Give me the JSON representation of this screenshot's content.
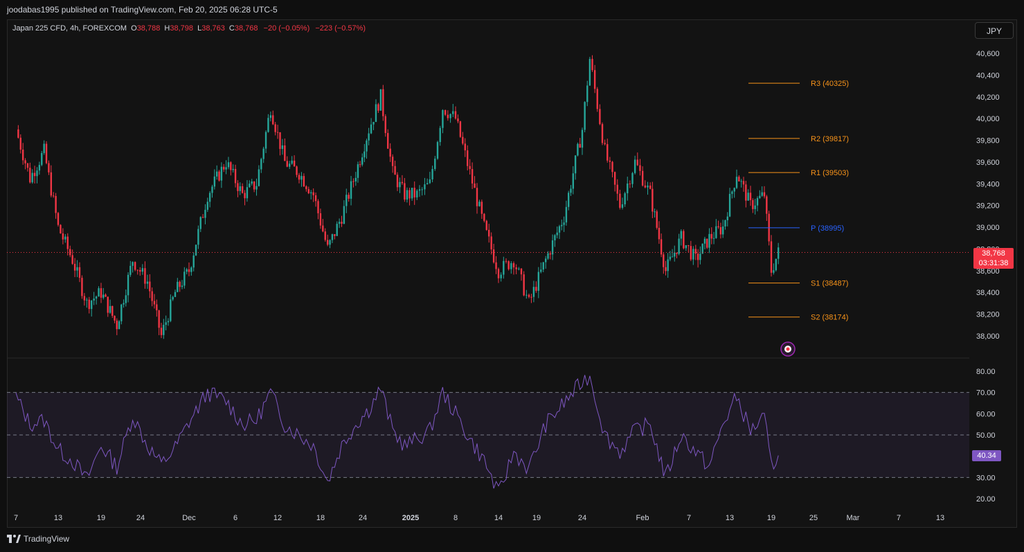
{
  "header": {
    "publisher": "joodabas1995 published on TradingView.com, Feb 20, 2025 06:28 UTC-5"
  },
  "legend": {
    "symbol": "Japan 225 CFD, 4h, FOREXCOM",
    "o_label": "O",
    "o_value": "38,788",
    "h_label": "H",
    "h_value": "38,798",
    "l_label": "L",
    "l_value": "38,763",
    "c_label": "C",
    "c_value": "38,768",
    "change": "−20 (−0.05%)",
    "change_total": "−223 (−0.57%)"
  },
  "currency_button": "JPY",
  "last_price_tag": {
    "price": "38,768",
    "countdown": "03:31:38"
  },
  "rsi_tag": "40.34",
  "footer": {
    "brand": "TradingView"
  },
  "colors": {
    "up": "#26a69a",
    "down": "#f23645",
    "pivot_orange": "#f7931a",
    "pivot_blue": "#2962ff",
    "rsi_line": "#7e57c2",
    "background": "#131313"
  },
  "chart_data": [
    {
      "type": "candlestick",
      "symbol": "Japan 225 CFD",
      "timeframe": "4h",
      "y_ticks": [
        "38,000",
        "38,200",
        "38,400",
        "38,600",
        "38,800",
        "39,000",
        "39,200",
        "39,400",
        "39,600",
        "39,800",
        "40,000",
        "40,200",
        "40,400",
        "40,600"
      ],
      "y_tick_values": [
        38000,
        38200,
        38400,
        38600,
        38800,
        39000,
        39200,
        39400,
        39600,
        39800,
        40000,
        40200,
        40400,
        40600
      ],
      "ylim": [
        37800,
        40750
      ],
      "x_ticks": [
        "7",
        "13",
        "19",
        "24",
        "Dec",
        "6",
        "12",
        "18",
        "24",
        "2025",
        "8",
        "14",
        "19",
        "24",
        "Feb",
        "7",
        "13",
        "19",
        "25",
        "Mar",
        "7",
        "13"
      ],
      "approx_path": [
        {
          "x": "Nov 7",
          "y": 39900
        },
        {
          "x": "Nov 9",
          "y": 39450
        },
        {
          "x": "Nov 11",
          "y": 39700
        },
        {
          "x": "Nov 13",
          "y": 39000
        },
        {
          "x": "Nov 15",
          "y": 38700
        },
        {
          "x": "Nov 17",
          "y": 38300
        },
        {
          "x": "Nov 19",
          "y": 38400
        },
        {
          "x": "Nov 21",
          "y": 38100
        },
        {
          "x": "Nov 23",
          "y": 38700
        },
        {
          "x": "Nov 25",
          "y": 38500
        },
        {
          "x": "Nov 27",
          "y": 38000
        },
        {
          "x": "Nov 29",
          "y": 38400
        },
        {
          "x": "Dec 1",
          "y": 38600
        },
        {
          "x": "Dec 3",
          "y": 39300
        },
        {
          "x": "Dec 5",
          "y": 39600
        },
        {
          "x": "Dec 7",
          "y": 39300
        },
        {
          "x": "Dec 9",
          "y": 39400
        },
        {
          "x": "Dec 11",
          "y": 40100
        },
        {
          "x": "Dec 13",
          "y": 39600
        },
        {
          "x": "Dec 15",
          "y": 39500
        },
        {
          "x": "Dec 17",
          "y": 39300
        },
        {
          "x": "Dec 19",
          "y": 38800
        },
        {
          "x": "Dec 21",
          "y": 39100
        },
        {
          "x": "Dec 23",
          "y": 39500
        },
        {
          "x": "Dec 25",
          "y": 39900
        },
        {
          "x": "Dec 27",
          "y": 40200
        },
        {
          "x": "Dec 29",
          "y": 39500
        },
        {
          "x": "Dec 31",
          "y": 39300
        },
        {
          "x": "Jan 2",
          "y": 39300
        },
        {
          "x": "Jan 4",
          "y": 39400
        },
        {
          "x": "Jan 6",
          "y": 40100
        },
        {
          "x": "Jan 8",
          "y": 40000
        },
        {
          "x": "Jan 10",
          "y": 39500
        },
        {
          "x": "Jan 12",
          "y": 39000
        },
        {
          "x": "Jan 14",
          "y": 38600
        },
        {
          "x": "Jan 16",
          "y": 38700
        },
        {
          "x": "Jan 18",
          "y": 38300
        },
        {
          "x": "Jan 20",
          "y": 38700
        },
        {
          "x": "Jan 22",
          "y": 39100
        },
        {
          "x": "Jan 24",
          "y": 39900
        },
        {
          "x": "Jan 25",
          "y": 40550
        },
        {
          "x": "Jan 27",
          "y": 39700
        },
        {
          "x": "Jan 29",
          "y": 39200
        },
        {
          "x": "Jan 31",
          "y": 39600
        },
        {
          "x": "Feb 2",
          "y": 39300
        },
        {
          "x": "Feb 4",
          "y": 38600
        },
        {
          "x": "Feb 6",
          "y": 38900
        },
        {
          "x": "Feb 8",
          "y": 38700
        },
        {
          "x": "Feb 10",
          "y": 38900
        },
        {
          "x": "Feb 12",
          "y": 39000
        },
        {
          "x": "Feb 14",
          "y": 39500
        },
        {
          "x": "Feb 16",
          "y": 39200
        },
        {
          "x": "Feb 18",
          "y": 39300
        },
        {
          "x": "Feb 19",
          "y": 38600
        },
        {
          "x": "Feb 20",
          "y": 38768
        }
      ],
      "pivots": [
        {
          "label": "R3 (40325)",
          "value": 40325,
          "color": "#f7931a"
        },
        {
          "label": "R2 (39817)",
          "value": 39817,
          "color": "#f7931a"
        },
        {
          "label": "R1 (39503)",
          "value": 39503,
          "color": "#f7931a"
        },
        {
          "label": "P (38995)",
          "value": 38995,
          "color": "#2962ff"
        },
        {
          "label": "S1 (38487)",
          "value": 38487,
          "color": "#f7931a"
        },
        {
          "label": "S2 (38174)",
          "value": 38174,
          "color": "#f7931a"
        }
      ],
      "last_price": 38768
    },
    {
      "type": "line",
      "y_ticks": [
        "20.00",
        "30.00",
        "40.00",
        "50.00",
        "60.00",
        "70.00",
        "80.00"
      ],
      "y_tick_values": [
        20,
        30,
        40,
        50,
        60,
        70,
        80
      ],
      "ylim": [
        17,
        82
      ],
      "bands": [
        70,
        50,
        30
      ],
      "approx_path": [
        {
          "x": "Nov 7",
          "y": 68
        },
        {
          "x": "Nov 9",
          "y": 55
        },
        {
          "x": "Nov 11",
          "y": 57
        },
        {
          "x": "Nov 13",
          "y": 43
        },
        {
          "x": "Nov 15",
          "y": 38
        },
        {
          "x": "Nov 17",
          "y": 29
        },
        {
          "x": "Nov 19",
          "y": 45
        },
        {
          "x": "Nov 21",
          "y": 35
        },
        {
          "x": "Nov 23",
          "y": 59
        },
        {
          "x": "Nov 25",
          "y": 45
        },
        {
          "x": "Nov 27",
          "y": 36
        },
        {
          "x": "Nov 29",
          "y": 44
        },
        {
          "x": "Dec 1",
          "y": 56
        },
        {
          "x": "Dec 3",
          "y": 70
        },
        {
          "x": "Dec 5",
          "y": 66
        },
        {
          "x": "Dec 7",
          "y": 55
        },
        {
          "x": "Dec 9",
          "y": 57
        },
        {
          "x": "Dec 11",
          "y": 70
        },
        {
          "x": "Dec 13",
          "y": 55
        },
        {
          "x": "Dec 15",
          "y": 50
        },
        {
          "x": "Dec 17",
          "y": 45
        },
        {
          "x": "Dec 19",
          "y": 28
        },
        {
          "x": "Dec 21",
          "y": 45
        },
        {
          "x": "Dec 23",
          "y": 55
        },
        {
          "x": "Dec 25",
          "y": 62
        },
        {
          "x": "Dec 27",
          "y": 72
        },
        {
          "x": "Dec 29",
          "y": 52
        },
        {
          "x": "Dec 31",
          "y": 45
        },
        {
          "x": "Jan 2",
          "y": 48
        },
        {
          "x": "Jan 4",
          "y": 52
        },
        {
          "x": "Jan 6",
          "y": 70
        },
        {
          "x": "Jan 8",
          "y": 60
        },
        {
          "x": "Jan 10",
          "y": 48
        },
        {
          "x": "Jan 12",
          "y": 38
        },
        {
          "x": "Jan 14",
          "y": 22
        },
        {
          "x": "Jan 16",
          "y": 42
        },
        {
          "x": "Jan 18",
          "y": 34
        },
        {
          "x": "Jan 20",
          "y": 55
        },
        {
          "x": "Jan 22",
          "y": 65
        },
        {
          "x": "Jan 24",
          "y": 75
        },
        {
          "x": "Jan 25",
          "y": 78
        },
        {
          "x": "Jan 27",
          "y": 50
        },
        {
          "x": "Jan 29",
          "y": 42
        },
        {
          "x": "Jan 31",
          "y": 52
        },
        {
          "x": "Feb 2",
          "y": 55
        },
        {
          "x": "Feb 4",
          "y": 30
        },
        {
          "x": "Feb 6",
          "y": 50
        },
        {
          "x": "Feb 8",
          "y": 42
        },
        {
          "x": "Feb 10",
          "y": 35
        },
        {
          "x": "Feb 12",
          "y": 55
        },
        {
          "x": "Feb 14",
          "y": 68
        },
        {
          "x": "Feb 16",
          "y": 52
        },
        {
          "x": "Feb 18",
          "y": 58
        },
        {
          "x": "Feb 19",
          "y": 35
        },
        {
          "x": "Feb 20",
          "y": 40.34
        }
      ],
      "last_value": 40.34
    }
  ]
}
